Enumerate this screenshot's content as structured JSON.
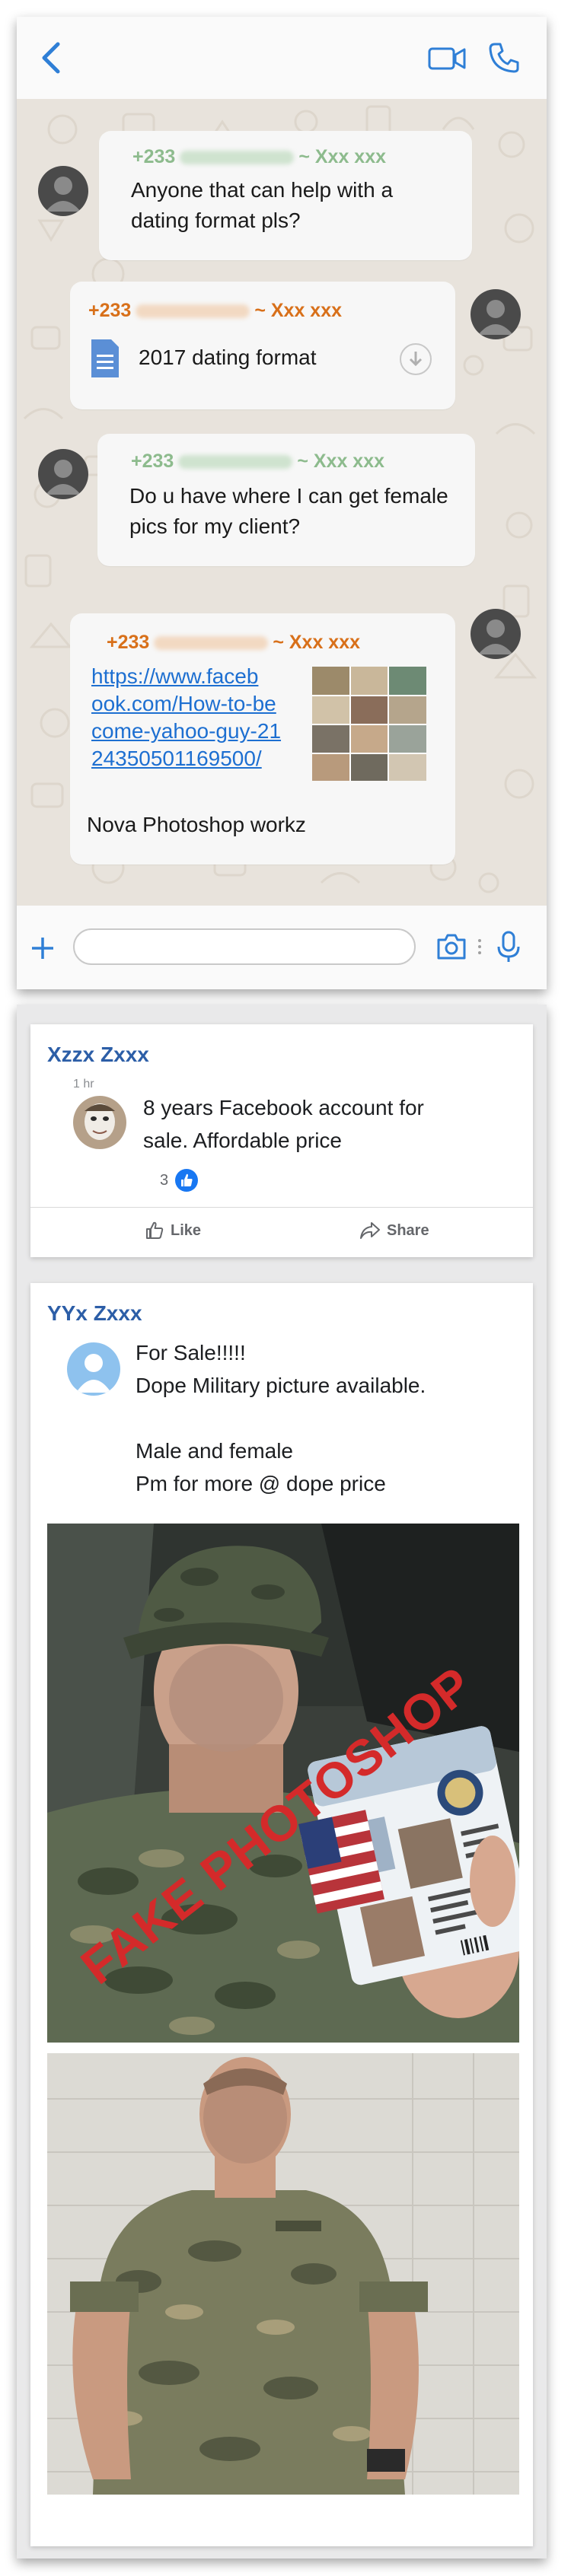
{
  "chat": {
    "messages": [
      {
        "sender_number": "+233",
        "sender_sep": "~",
        "sender_name": "Xxx xxx",
        "text_lines": [
          "Anyone that can help with a",
          "dating format pls?"
        ]
      },
      {
        "sender_number": "+233",
        "sender_sep": "~",
        "sender_name": "Xxx xxx",
        "file_name": "2017 dating format"
      },
      {
        "sender_number": "+233",
        "sender_sep": "~",
        "sender_name": "Xxx xxx",
        "text_lines": [
          "Do u have where I can get female",
          "pics for my client?"
        ]
      },
      {
        "sender_number": "+233",
        "sender_sep": "~",
        "sender_name": "Xxx xxx",
        "link_lines": [
          "https://www.faceb",
          "ook.com/How-to-be",
          "come-yahoo-guy-21",
          "24350501169500/"
        ],
        "text": "Nova Photoshop workz"
      }
    ],
    "colors": {
      "link": "#1d6fd1",
      "accent": "#2f7fd6",
      "sender_green": "#8dbb8d",
      "sender_orange": "#d8701a"
    },
    "icons": [
      "back-chevron-icon",
      "video-call-icon",
      "voice-call-icon",
      "plus-icon",
      "camera-icon",
      "microphone-icon",
      "document-icon",
      "download-icon"
    ]
  },
  "facebook": {
    "post1": {
      "author": "Xzzx Zxxx",
      "time": "1 hr",
      "text_lines": [
        "8 years Facebook account for",
        "sale. Affordable price"
      ],
      "like_count": "3",
      "like_label": "Like",
      "share_label": "Share"
    },
    "post2": {
      "author": "YYx Zxxx",
      "text_lines": [
        "For Sale!!!!!",
        "Dope Military picture available.",
        "",
        "Male and female",
        "Pm for more @ dope price"
      ],
      "watermark": "FAKE PHOTOSHOP"
    },
    "colors": {
      "author": "#2c5ea7",
      "like_badge": "#1877f2",
      "watermark": "#d42a2a"
    }
  }
}
